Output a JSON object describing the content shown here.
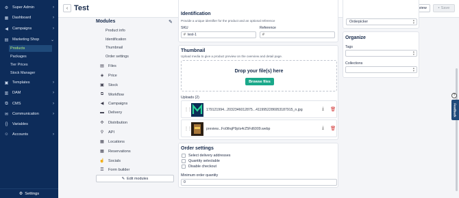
{
  "sidebar": {
    "items": [
      {
        "label": "Super Admin",
        "icon": "user-gear-icon"
      },
      {
        "label": "Dashboard",
        "icon": "dashboard-icon"
      },
      {
        "label": "Campaigns",
        "icon": "megaphone-icon"
      },
      {
        "label": "Marketing Shop",
        "icon": "store-icon"
      },
      {
        "label": "Templates",
        "icon": "template-icon"
      },
      {
        "label": "DAM",
        "icon": "dam-icon"
      },
      {
        "label": "CMS",
        "icon": "cms-icon"
      },
      {
        "label": "Communication",
        "icon": "chat-icon"
      },
      {
        "label": "Variables",
        "icon": "variables-icon"
      },
      {
        "label": "Accounts",
        "icon": "accounts-icon"
      }
    ],
    "sub_items": [
      "Products",
      "Packages",
      "Tier Prices",
      "Stock Manager"
    ],
    "active_sub": "Products",
    "settings_label": "Settings"
  },
  "header": {
    "title": "Test",
    "preview_label": "Preview",
    "save_label": "Save"
  },
  "modules": {
    "title": "Modules",
    "sub_items": [
      "Product info",
      "Identification",
      "Thumbnail",
      "Order settings"
    ],
    "items": [
      {
        "label": "Files",
        "icon": "files-icon"
      },
      {
        "label": "Price",
        "icon": "price-tag-icon"
      },
      {
        "label": "Stock",
        "icon": "stock-icon"
      },
      {
        "label": "Workflow",
        "icon": "workflow-icon"
      },
      {
        "label": "Campaigns",
        "icon": "megaphone-icon"
      },
      {
        "label": "Delivery",
        "icon": "truck-icon"
      },
      {
        "label": "Distribution",
        "icon": "distribution-icon"
      },
      {
        "label": "API",
        "icon": "api-icon"
      },
      {
        "label": "Locations",
        "icon": "locations-icon"
      },
      {
        "label": "Reservations",
        "icon": "calendar-icon"
      },
      {
        "label": "Socials",
        "icon": "thumbs-up-icon"
      },
      {
        "label": "Form builder",
        "icon": "form-icon"
      }
    ],
    "edit_label": "Edit modules"
  },
  "identification": {
    "title": "Identification",
    "subtitle": "Provide a unique identifier for the product and an optional reference",
    "sku_label": "SKU",
    "sku_value": "test-1",
    "reference_label": "Reference",
    "reference_value": ""
  },
  "thumbnail": {
    "title": "Thumbnail",
    "subtitle": "Upload media to give a product preview on the overview and detail page.",
    "drop_title": "Drop your file(s) here",
    "browse_label": "Browse files",
    "uploads_label": "Uploads (2)",
    "uploads": [
      {
        "name": "179121994...2032346012875...4119952286953187915_n.jpg"
      },
      {
        "name": "preview...Fo0thqP9pIs4rZ5Fd6009.webp"
      }
    ]
  },
  "order_settings": {
    "title": "Order settings",
    "checkboxes": [
      "Select delivery addresses",
      "Quantity selectable",
      "Disable checkout"
    ],
    "min_qty_label": "Minimum order quantity",
    "min_qty_value": "0"
  },
  "right_panel": {
    "orderpicker_value": "Orderpicker",
    "organize_title": "Organize",
    "tags_label": "Tags",
    "collections_label": "Collections"
  },
  "feedback_label": "Feedback",
  "colors": {
    "sidebar_bg": "#0d2c5a",
    "accent_green": "#b7f07a",
    "primary_button": "#1aa88a",
    "danger": "#d23b3b"
  }
}
